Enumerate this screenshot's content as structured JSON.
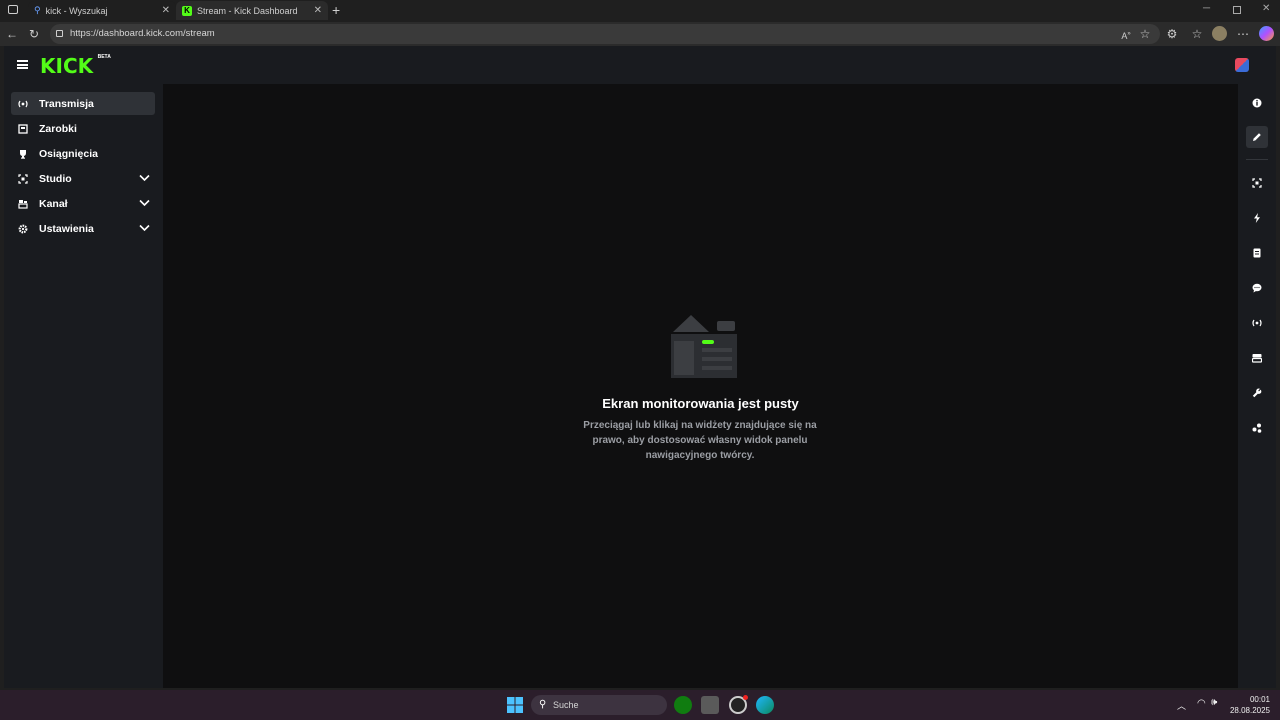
{
  "browser": {
    "tabs": [
      {
        "title": "kick - Wyszukaj",
        "active": false
      },
      {
        "title": "Stream - Kick Dashboard",
        "active": true
      }
    ],
    "url": "https://dashboard.kick.com/stream"
  },
  "app": {
    "logo": "KICK",
    "logo_badge": "BETA",
    "accent_color": "#53fc18"
  },
  "sidebar": {
    "items": [
      {
        "label": "Transmisja",
        "icon": "broadcast-icon",
        "active": true,
        "expandable": false
      },
      {
        "label": "Zarobki",
        "icon": "wallet-icon",
        "active": false,
        "expandable": false
      },
      {
        "label": "Osiągnięcia",
        "icon": "trophy-icon",
        "active": false,
        "expandable": false
      },
      {
        "label": "Studio",
        "icon": "studio-icon",
        "active": false,
        "expandable": true
      },
      {
        "label": "Kanał",
        "icon": "channel-icon",
        "active": false,
        "expandable": true
      },
      {
        "label": "Ustawienia",
        "icon": "gear-icon",
        "active": false,
        "expandable": true
      }
    ]
  },
  "main": {
    "empty_title": "Ekran monitorowania jest pusty",
    "empty_description": "Przeciągaj lub klikaj na widżety znajdujące się na prawo, aby dostosować własny widok panelu nawigacyjnego twórcy."
  },
  "rightbar": {
    "icons": [
      "info-icon",
      "pencil-icon",
      "focus-icon",
      "lightning-icon",
      "notes-icon",
      "chat-icon",
      "broadcast-icon",
      "layers-icon",
      "wrench-icon",
      "connections-icon"
    ]
  },
  "taskbar": {
    "search_label": "Suche",
    "time": "00:01",
    "date": "28.08.2025"
  }
}
